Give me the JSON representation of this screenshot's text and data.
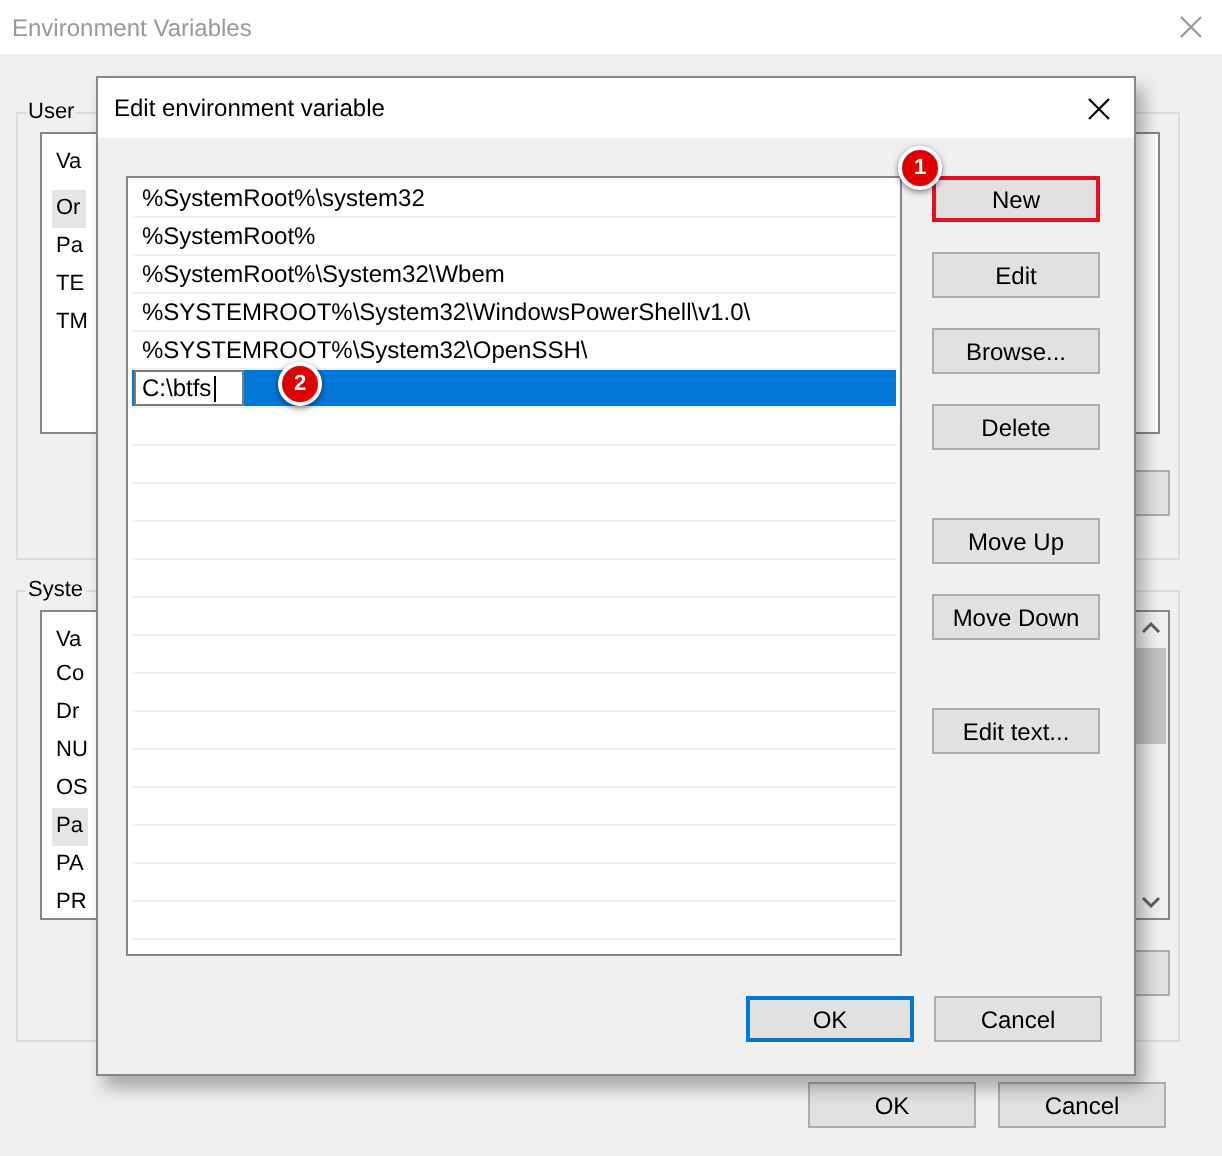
{
  "background_window": {
    "title": "Environment Variables",
    "user_group": {
      "legend": "User",
      "header": "Va",
      "rows": [
        {
          "text": "Or",
          "selected": true
        },
        {
          "text": "Pa",
          "selected": false
        },
        {
          "text": "TE",
          "selected": false
        },
        {
          "text": "TM",
          "selected": false
        }
      ]
    },
    "system_group": {
      "legend": "Syste",
      "header": "Va",
      "rows": [
        {
          "text": "Co",
          "selected": false
        },
        {
          "text": "Dr",
          "selected": false
        },
        {
          "text": "NU",
          "selected": false
        },
        {
          "text": "OS",
          "selected": false
        },
        {
          "text": "Pa",
          "selected": true
        },
        {
          "text": "PA",
          "selected": false
        },
        {
          "text": "PR",
          "selected": false
        }
      ]
    },
    "buttons": [
      {
        "label": "OK"
      },
      {
        "label": "Cancel"
      }
    ]
  },
  "dialog": {
    "title": "Edit environment variable",
    "items": [
      {
        "text": "%SystemRoot%\\system32",
        "selected": false,
        "editing": false
      },
      {
        "text": "%SystemRoot%",
        "selected": false,
        "editing": false
      },
      {
        "text": "%SystemRoot%\\System32\\Wbem",
        "selected": false,
        "editing": false
      },
      {
        "text": "%SYSTEMROOT%\\System32\\WindowsPowerShell\\v1.0\\",
        "selected": false,
        "editing": false
      },
      {
        "text": "%SYSTEMROOT%\\System32\\OpenSSH\\",
        "selected": false,
        "editing": false
      },
      {
        "text": "C:\\btfs",
        "selected": true,
        "editing": true,
        "badge": "2"
      }
    ],
    "button_groups": [
      [
        {
          "label": "New",
          "highlighted": true,
          "badge": "1"
        },
        {
          "label": "Edit",
          "highlighted": false
        },
        {
          "label": "Browse...",
          "highlighted": false
        },
        {
          "label": "Delete",
          "highlighted": false
        }
      ],
      [
        {
          "label": "Move Up",
          "highlighted": false
        },
        {
          "label": "Move Down",
          "highlighted": false
        }
      ],
      [
        {
          "label": "Edit text...",
          "highlighted": false
        }
      ]
    ],
    "footer_buttons": [
      {
        "label": "OK",
        "default": true
      },
      {
        "label": "Cancel",
        "default": false
      }
    ]
  }
}
